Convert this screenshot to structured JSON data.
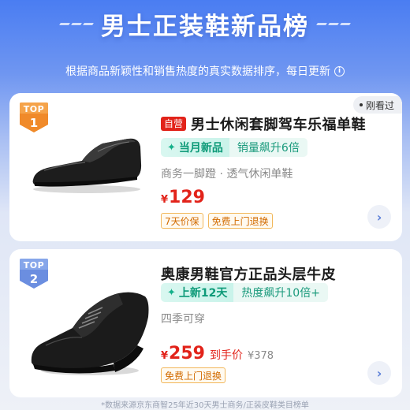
{
  "header": {
    "title": "男士正装鞋新品榜",
    "subtitle": "根据商品新颖性和销售热度的真实数据排序，每日更新",
    "info_icon": "info-icon"
  },
  "products": [
    {
      "rank_label": "TOP",
      "rank": "1",
      "seen_label": "刚看过",
      "self_tag": "自营",
      "name": "男士休闲套脚驾车乐福单鞋",
      "new_tag": "当月新品",
      "heat": "销量飙升6倍",
      "feature": "商务一脚蹬 · 透气休闲单鞋",
      "price_symbol": "¥",
      "price": "129",
      "promos": [
        "7天价保",
        "免费上门退换"
      ],
      "badge_color": "#f08a2a"
    },
    {
      "rank_label": "TOP",
      "rank": "2",
      "name": "奥康男鞋官方正品头层牛皮",
      "new_tag": "上新12天",
      "heat": "热度飙升10倍+",
      "feature": "四季可穿",
      "price_symbol": "¥",
      "price": "259",
      "deal_text": "到手价",
      "old_price": "¥378",
      "promos": [
        "免费上门退换"
      ],
      "badge_color": "#6b8ee0"
    }
  ],
  "footer": {
    "text": "*数据来源京东商智25年近30天男士商务/正装皮鞋类目榜单"
  }
}
